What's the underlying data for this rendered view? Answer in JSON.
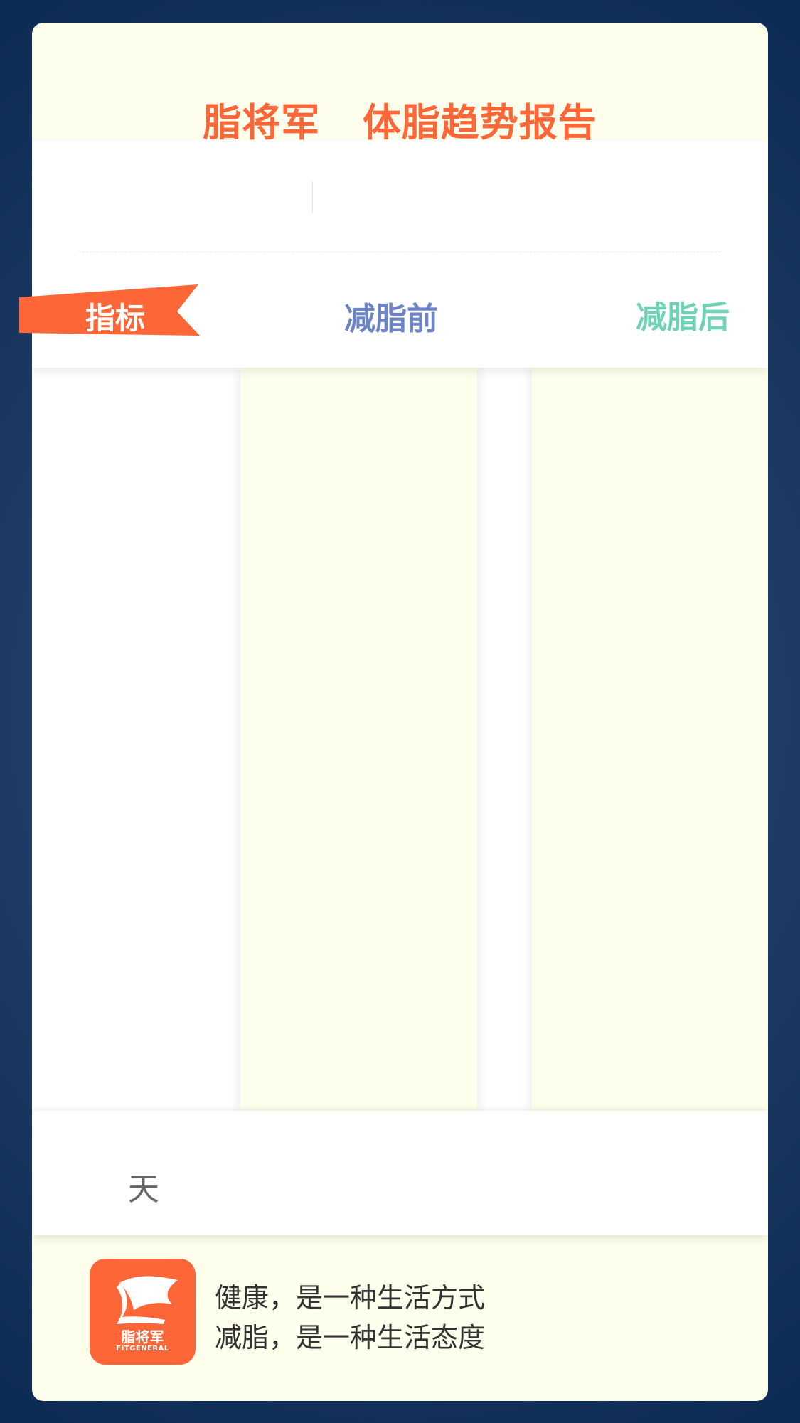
{
  "header": {
    "title": "脂将军   体脂趋势报告"
  },
  "table": {
    "indicator_label": "指标",
    "before_label": "减脂前",
    "after_label": "减脂后",
    "ribbon_color": "#fd6737",
    "before_color": "#6d83c7",
    "after_color": "#6fd2b4"
  },
  "duration": {
    "unit": "天"
  },
  "footer": {
    "logo": {
      "name": "脂将军",
      "subtitle": "FITGENERAL",
      "color": "#fd6737"
    },
    "slogan_line1": "健康，是一种生活方式",
    "slogan_line2": "减脂，是一种生活态度"
  },
  "colors": {
    "accent": "#fd6737",
    "card_background": "#fefeec",
    "page_background": "#1c3a63"
  }
}
